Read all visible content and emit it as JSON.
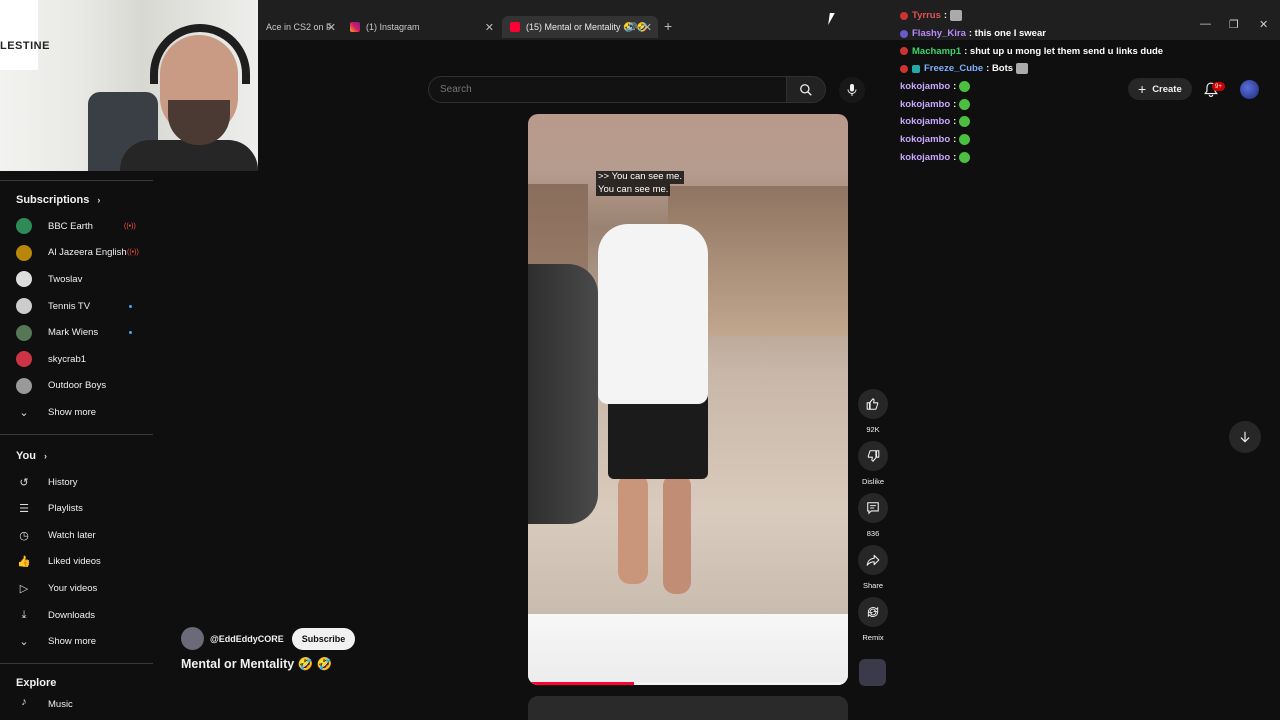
{
  "browser": {
    "tabs": [
      {
        "title": "Ace in CS2 on F",
        "active": false
      },
      {
        "title": "(1) Instagram",
        "active": false
      },
      {
        "title": "(15) Mental or Mentality 🤣 🤣",
        "active": true
      }
    ],
    "new_tab": "+"
  },
  "webcam": {
    "flag_text": "LESTINE"
  },
  "search": {
    "placeholder": "Search"
  },
  "header": {
    "create_label": "Create",
    "notif_badge": "9+"
  },
  "chat": {
    "messages": [
      {
        "user": "Tyrrus",
        "text": ":",
        "color": "#e05353",
        "badge": "#c33"
      },
      {
        "user": "Flashy_Kira",
        "text": ": this one I swear",
        "color": "#b78aff",
        "badge": "#6a5acd"
      },
      {
        "user": "Machamp1",
        "text": ": shut up u mong let them send u links dude",
        "color": "#3cd46e",
        "badge": "#c33"
      },
      {
        "user": "Freeze_Cube",
        "text": ": Bots",
        "color": "#7fb0ff",
        "badge": "#2aa"
      },
      {
        "user": "kokojambo",
        "text": ":",
        "color": "#c8a8ff",
        "badge": ""
      },
      {
        "user": "kokojambo",
        "text": ":",
        "color": "#c8a8ff",
        "badge": ""
      },
      {
        "user": "kokojambo",
        "text": ":",
        "color": "#c8a8ff",
        "badge": ""
      },
      {
        "user": "kokojambo",
        "text": ":",
        "color": "#c8a8ff",
        "badge": ""
      },
      {
        "user": "kokojambo",
        "text": ":",
        "color": "#c8a8ff",
        "badge": ""
      }
    ]
  },
  "sidebar": {
    "subscriptions_title": "Subscriptions",
    "subscriptions": [
      {
        "label": "BBC Earth",
        "status": "live",
        "color": "#2e8b57"
      },
      {
        "label": "Al Jazeera English",
        "status": "live",
        "color": "#b8860b"
      },
      {
        "label": "Twoslav",
        "status": "",
        "color": "#ddd"
      },
      {
        "label": "Tennis TV",
        "status": "new",
        "color": "#ccc"
      },
      {
        "label": "Mark Wiens",
        "status": "new",
        "color": "#557755"
      },
      {
        "label": "skycrab1",
        "status": "",
        "color": "#cc3344"
      },
      {
        "label": "Outdoor Boys",
        "status": "",
        "color": "#999"
      }
    ],
    "subs_show_more": "Show more",
    "you_title": "You",
    "you_items": [
      {
        "label": "History",
        "icon": "history-icon",
        "glyph": "↺"
      },
      {
        "label": "Playlists",
        "icon": "playlists-icon",
        "glyph": "☰"
      },
      {
        "label": "Watch later",
        "icon": "watch-later-icon",
        "glyph": "◷"
      },
      {
        "label": "Liked videos",
        "icon": "like-icon",
        "glyph": "👍"
      },
      {
        "label": "Your videos",
        "icon": "your-videos-icon",
        "glyph": "▷"
      },
      {
        "label": "Downloads",
        "icon": "download-icon",
        "glyph": "⤓"
      }
    ],
    "you_show_more": "Show more",
    "explore_title": "Explore",
    "explore_partial": "Music"
  },
  "video": {
    "caption_line1": ">> You can see me.",
    "caption_line2": "You can see me.",
    "progress": 0.33
  },
  "actions": {
    "like_count": "92K",
    "dislike_label": "Dislike",
    "comment_count": "836",
    "share_label": "Share",
    "remix_label": "Remix"
  },
  "channel": {
    "handle": "@EddEddyCORE",
    "subscribe_label": "Subscribe",
    "title": "Mental or Mentality 🤣 🤣"
  }
}
